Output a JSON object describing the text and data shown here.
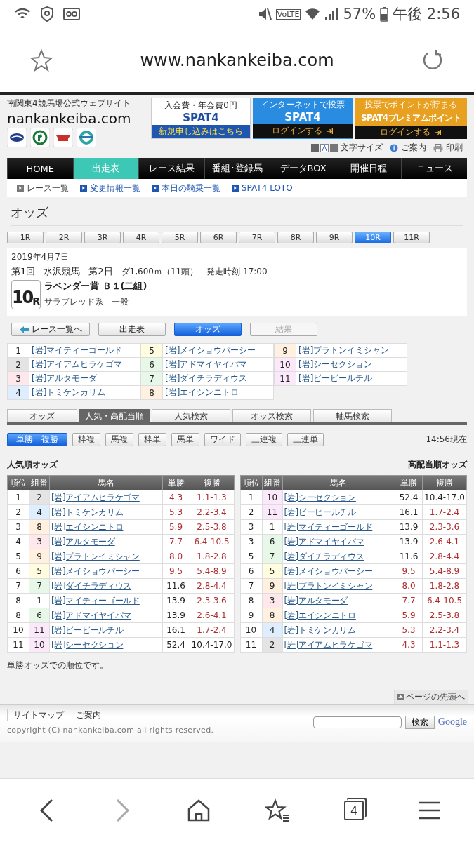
{
  "status_bar": {
    "network": "VoLTE",
    "battery": "57%",
    "time": "午後 2:56"
  },
  "browser": {
    "url": "www.nankankeiba.com",
    "tab_count": "4"
  },
  "site_header": {
    "tagline": "南関東4競馬場公式ウェブサイト",
    "logo": "nankankeiba.com"
  },
  "banners": [
    {
      "kind": "signup",
      "top": "入会費・年会費0円",
      "title": "SPAT4",
      "bottom": "新規申し込みはこちら"
    },
    {
      "kind": "login",
      "top": "インターネットで投票",
      "title": "SPAT4",
      "bottom": "ログインする"
    },
    {
      "kind": "points",
      "top": "投票でポイントが貯まる",
      "title": "SPAT4プレミアムポイント",
      "bottom": "ログインする"
    }
  ],
  "tools": {
    "text_size": "文字サイズ",
    "guide": "ご案内",
    "print": "印刷"
  },
  "nav": [
    {
      "label": "HOME",
      "selected": false
    },
    {
      "label": "出走表",
      "selected": true
    },
    {
      "label": "レース結果",
      "selected": false
    },
    {
      "label": "番組･登録馬",
      "selected": false
    },
    {
      "label": "データBOX",
      "selected": false
    },
    {
      "label": "開催日程",
      "selected": false
    },
    {
      "label": "ニュース",
      "selected": false
    }
  ],
  "subnav": [
    {
      "label": "レース一覧",
      "kind": "current"
    },
    {
      "label": "変更情報一覧",
      "kind": "link"
    },
    {
      "label": "本日の騎乗一覧",
      "kind": "link"
    },
    {
      "label": "SPAT4 LOTO",
      "kind": "link"
    }
  ],
  "page_title": "オッズ",
  "race_tabs": [
    {
      "label": "1R",
      "selected": false
    },
    {
      "label": "2R",
      "selected": false
    },
    {
      "label": "3R",
      "selected": false
    },
    {
      "label": "4R",
      "selected": false
    },
    {
      "label": "5R",
      "selected": false
    },
    {
      "label": "6R",
      "selected": false
    },
    {
      "label": "7R",
      "selected": false
    },
    {
      "label": "8R",
      "selected": false
    },
    {
      "label": "9R",
      "selected": false
    },
    {
      "label": "10R",
      "selected": true
    },
    {
      "label": "11R",
      "selected": false
    }
  ],
  "race_info": {
    "date": "2019年4月7日",
    "meeting": "第1回",
    "venue": "水沢競馬",
    "day": "第2日",
    "course": "ダ1,600ｍ（11頭）",
    "start": "発走時刻 17:00",
    "race_number": "10",
    "race_unit": "R",
    "race_name": "ラベンダー賞 Ｂ１(二組)",
    "category": "サラブレッド系　一般"
  },
  "race_buttons": [
    {
      "label": "レース一覧へ",
      "kind": "back",
      "selected": false,
      "disabled": false
    },
    {
      "label": "出走表",
      "kind": "plain",
      "selected": false,
      "disabled": false
    },
    {
      "label": "オッズ",
      "kind": "plain",
      "selected": true,
      "disabled": false
    },
    {
      "label": "結果",
      "kind": "plain",
      "selected": false,
      "disabled": true
    }
  ],
  "horses": [
    {
      "number": "1",
      "name": "[岩]マイティーゴールド",
      "color": "#ffffff"
    },
    {
      "number": "2",
      "name": "[岩]アイアムヒラケゴマ",
      "color": "#e4e4e4"
    },
    {
      "number": "3",
      "name": "[岩]アルタモーダ",
      "color": "#ffe8ec"
    },
    {
      "number": "4",
      "name": "[岩]トミケンカリム",
      "color": "#deeeff"
    },
    {
      "number": "5",
      "name": "[岩]メイショウパーシー",
      "color": "#fffce0"
    },
    {
      "number": "6",
      "name": "[岩]アドマイヤイパマ",
      "color": "#e8f8e8"
    },
    {
      "number": "7",
      "name": "[岩]ダイチラディウス",
      "color": "#e8f8e8"
    },
    {
      "number": "8",
      "name": "[岩]エイシンニトロ",
      "color": "#fff0e0"
    },
    {
      "number": "9",
      "name": "[岩]プラトンイミシャン",
      "color": "#fff0e0"
    },
    {
      "number": "10",
      "name": "[岩]シーセクション",
      "color": "#fbe9fb"
    },
    {
      "number": "11",
      "name": "[岩]ビービールチル",
      "color": "#fbe9fb"
    }
  ],
  "odds_tabs": [
    {
      "label": "オッズ",
      "selected": false
    },
    {
      "label": "人気・高配当順",
      "selected": true
    },
    {
      "label": "人気検索",
      "selected": false
    },
    {
      "label": "オッズ検索",
      "selected": false
    },
    {
      "label": "軸馬検索",
      "selected": false
    }
  ],
  "bet_types": [
    {
      "label": "単勝　複勝",
      "selected": true
    },
    {
      "label": "枠複",
      "selected": false
    },
    {
      "label": "馬複",
      "selected": false
    },
    {
      "label": "枠単",
      "selected": false
    },
    {
      "label": "馬単",
      "selected": false
    },
    {
      "label": "ワイド",
      "selected": false
    },
    {
      "label": "三連複",
      "selected": false
    },
    {
      "label": "三連単",
      "selected": false
    }
  ],
  "as_of": "14:56現在",
  "tables": [
    {
      "title": "人気順オッズ",
      "columns": [
        "順位",
        "組番",
        "馬名",
        "単勝",
        "複勝"
      ],
      "rows": [
        {
          "rank": "1",
          "number": "2",
          "color": "#e4e4e4",
          "name": "[岩]アイアムヒラケゴマ",
          "win": "4.3",
          "win_hot": true,
          "place": "1.1-1.3",
          "place_hot": true
        },
        {
          "rank": "2",
          "number": "4",
          "color": "#deeeff",
          "name": "[岩]トミケンカリム",
          "win": "5.3",
          "win_hot": true,
          "place": "2.2-3.4",
          "place_hot": true
        },
        {
          "rank": "3",
          "number": "8",
          "color": "#fff0e0",
          "name": "[岩]エイシンニトロ",
          "win": "5.9",
          "win_hot": true,
          "place": "2.5-3.8",
          "place_hot": true
        },
        {
          "rank": "4",
          "number": "3",
          "color": "#ffe8ec",
          "name": "[岩]アルタモーダ",
          "win": "7.7",
          "win_hot": true,
          "place": "6.4-10.5",
          "place_hot": true
        },
        {
          "rank": "5",
          "number": "9",
          "color": "#fff0e0",
          "name": "[岩]プラトンイミシャン",
          "win": "8.0",
          "win_hot": true,
          "place": "1.8-2.8",
          "place_hot": true
        },
        {
          "rank": "6",
          "number": "5",
          "color": "#fffce0",
          "name": "[岩]メイショウパーシー",
          "win": "9.5",
          "win_hot": true,
          "place": "5.4-8.9",
          "place_hot": true
        },
        {
          "rank": "7",
          "number": "7",
          "color": "#e8f8e8",
          "name": "[岩]ダイチラディウス",
          "win": "11.6",
          "win_hot": false,
          "place": "2.8-4.4",
          "place_hot": true
        },
        {
          "rank": "8",
          "number": "1",
          "color": "#ffffff",
          "name": "[岩]マイティーゴールド",
          "win": "13.9",
          "win_hot": false,
          "place": "2.3-3.6",
          "place_hot": true
        },
        {
          "rank": "8",
          "number": "6",
          "color": "#e8f8e8",
          "name": "[岩]アドマイヤイパマ",
          "win": "13.9",
          "win_hot": false,
          "place": "2.6-4.1",
          "place_hot": true
        },
        {
          "rank": "10",
          "number": "11",
          "color": "#fbe9fb",
          "name": "[岩]ビービールチル",
          "win": "16.1",
          "win_hot": false,
          "place": "1.7-2.4",
          "place_hot": true
        },
        {
          "rank": "11",
          "number": "10",
          "color": "#fbe9fb",
          "name": "[岩]シーセクション",
          "win": "52.4",
          "win_hot": false,
          "place": "10.4-17.0",
          "place_hot": false
        }
      ]
    },
    {
      "title": "高配当順オッズ",
      "columns": [
        "順位",
        "組番",
        "馬名",
        "単勝",
        "複勝"
      ],
      "rows": [
        {
          "rank": "1",
          "number": "10",
          "color": "#fbe9fb",
          "name": "[岩]シーセクション",
          "win": "52.4",
          "win_hot": false,
          "place": "10.4-17.0",
          "place_hot": false
        },
        {
          "rank": "2",
          "number": "11",
          "color": "#fbe9fb",
          "name": "[岩]ビービールチル",
          "win": "16.1",
          "win_hot": false,
          "place": "1.7-2.4",
          "place_hot": true
        },
        {
          "rank": "3",
          "number": "1",
          "color": "#ffffff",
          "name": "[岩]マイティーゴールド",
          "win": "13.9",
          "win_hot": false,
          "place": "2.3-3.6",
          "place_hot": true
        },
        {
          "rank": "3",
          "number": "6",
          "color": "#e8f8e8",
          "name": "[岩]アドマイヤイパマ",
          "win": "13.9",
          "win_hot": false,
          "place": "2.6-4.1",
          "place_hot": true
        },
        {
          "rank": "5",
          "number": "7",
          "color": "#e8f8e8",
          "name": "[岩]ダイチラディウス",
          "win": "11.6",
          "win_hot": false,
          "place": "2.8-4.4",
          "place_hot": true
        },
        {
          "rank": "6",
          "number": "5",
          "color": "#fffce0",
          "name": "[岩]メイショウパーシー",
          "win": "9.5",
          "win_hot": true,
          "place": "5.4-8.9",
          "place_hot": true
        },
        {
          "rank": "7",
          "number": "9",
          "color": "#fff0e0",
          "name": "[岩]プラトンイミシャン",
          "win": "8.0",
          "win_hot": true,
          "place": "1.8-2.8",
          "place_hot": true
        },
        {
          "rank": "8",
          "number": "3",
          "color": "#ffe8ec",
          "name": "[岩]アルタモーダ",
          "win": "7.7",
          "win_hot": true,
          "place": "6.4-10.5",
          "place_hot": true
        },
        {
          "rank": "9",
          "number": "8",
          "color": "#fff0e0",
          "name": "[岩]エイシンニトロ",
          "win": "5.9",
          "win_hot": true,
          "place": "2.5-3.8",
          "place_hot": true
        },
        {
          "rank": "10",
          "number": "4",
          "color": "#deeeff",
          "name": "[岩]トミケンカリム",
          "win": "5.3",
          "win_hot": true,
          "place": "2.2-3.4",
          "place_hot": true
        },
        {
          "rank": "11",
          "number": "2",
          "color": "#e4e4e4",
          "name": "[岩]アイアムヒラケゴマ",
          "win": "4.3",
          "win_hot": true,
          "place": "1.1-1.3",
          "place_hot": true
        }
      ]
    }
  ],
  "note": "単勝オッズでの順位です。",
  "page_top": "ページの先頭へ",
  "footer": {
    "links": [
      "サイトマップ",
      "ご案内"
    ],
    "search_button": "検索",
    "search_brand": "Google",
    "copyright": "copyright (C) nankankeiba.com all rights reserved."
  }
}
